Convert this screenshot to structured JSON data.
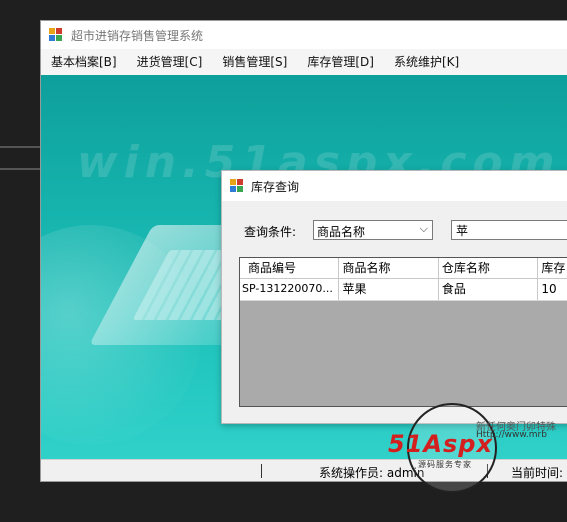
{
  "window": {
    "title": "超市进销存销售管理系统"
  },
  "menu": [
    {
      "label": "基本档案[B]"
    },
    {
      "label": "进货管理[C]"
    },
    {
      "label": "销售管理[S]"
    },
    {
      "label": "库存管理[D]"
    },
    {
      "label": "系统维护[K]"
    }
  ],
  "background": {
    "watermark": "win.51aspx.com"
  },
  "status": {
    "operator": "系统操作员: admin",
    "time_label": "当前时间:"
  },
  "dialog": {
    "title": "库存查询",
    "query_label": "查询条件:",
    "field_select": {
      "selected": "商品名称"
    },
    "query_value": "苹",
    "table": {
      "columns": [
        "商品编号",
        "商品名称",
        "仓库名称",
        "库存"
      ],
      "rows": [
        [
          "SP-131220070...",
          "苹果",
          "食品",
          "10"
        ]
      ]
    }
  },
  "stamp": {
    "brand": "51Aspx",
    "subtitle": "源码服务专家",
    "url": "Http://www.mrb",
    "top_text": "新任何奥门卯特殊"
  },
  "colors": {
    "desktop_teal": "#16b3ad",
    "dark_bg": "#1f1f1f",
    "stamp_red": "#d41f1f",
    "stamp_green": "#2b9a2b"
  }
}
